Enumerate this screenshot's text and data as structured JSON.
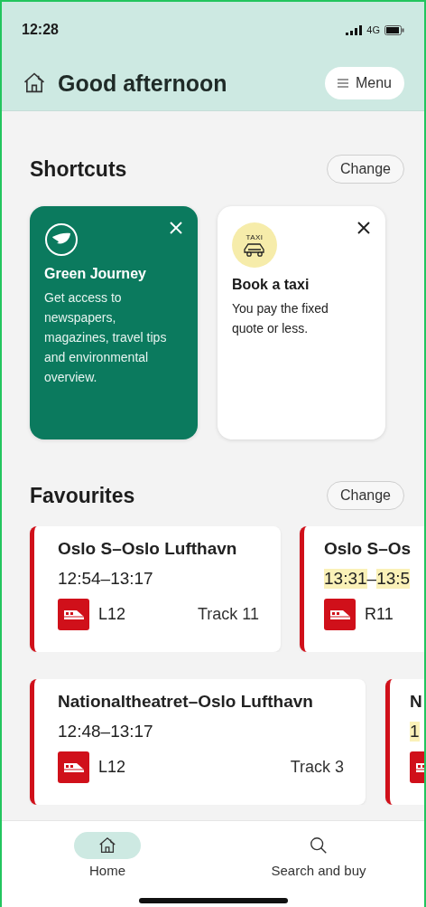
{
  "status_bar": {
    "time": "12:28",
    "network": "4G"
  },
  "header": {
    "title": "Good afternoon",
    "menu_label": "Menu"
  },
  "shortcuts": {
    "title": "Shortcuts",
    "change_label": "Change",
    "cards": [
      {
        "kind": "green",
        "title": "Green Journey",
        "text": "Get access to newspapers, magazines, travel tips and environmental overview."
      },
      {
        "kind": "taxi",
        "badge": "TAXI",
        "title": "Book a taxi",
        "text": "You pay the fixed quote or less."
      }
    ]
  },
  "favourites": {
    "title": "Favourites",
    "change_label": "Change",
    "rows": [
      [
        {
          "route": "Oslo S–Oslo Lufthavn",
          "departure": "12:54",
          "separator": "–",
          "arrival": "13:17",
          "changed": false,
          "line": "L12",
          "track": "Track 11"
        },
        {
          "route": "Oslo S–Os",
          "departure": "13:31",
          "separator": "–",
          "arrival": "13:5",
          "changed": true,
          "line": "R11"
        }
      ],
      [
        {
          "route": "Nationaltheatret–Oslo Lufthavn",
          "departure": "12:48",
          "separator": "–",
          "arrival": "13:17",
          "changed": false,
          "line": "L12",
          "track": "Track 3"
        },
        {
          "route": "N",
          "departure": "1",
          "changed": true
        }
      ]
    ]
  },
  "nav": [
    {
      "label": "Home",
      "kind": "home",
      "selected": true
    },
    {
      "label": "Search and buy",
      "kind": "search",
      "selected": false
    }
  ]
}
